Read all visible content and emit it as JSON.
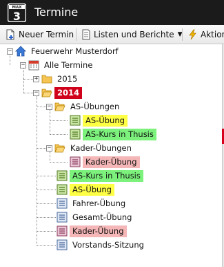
{
  "window": {
    "title": "Termine",
    "app_icon_text": "MAX",
    "app_icon_number": "3"
  },
  "toolbar": {
    "new_appointment": "Neuer Termin",
    "lists_reports": "Listen und Berichte",
    "actions": "Aktion"
  },
  "tree": {
    "root": "Feuerwehr Musterdorf",
    "all_appointments": "Alle Termine",
    "year_2015": "2015",
    "year_2014": "2014",
    "as_uebungen": "AS-Übungen",
    "as_uebung_1": "AS-Übung",
    "as_kurs_1": "AS-Kurs in Thusis",
    "kader_uebungen": "Kader-Übungen",
    "kader_uebung_1": "Kader-Übung",
    "as_kurs_2": "AS-Kurs in Thusis",
    "as_uebung_2": "AS-Übung",
    "fahrer_uebung": "Fahrer-Übung",
    "gesamt_uebung": "Gesamt-Übung",
    "kader_uebung_2": "Kader-Übung",
    "vorstands_sitzung": "Vorstands-Sitzung"
  },
  "colors": {
    "titlebar": "#1b1b1b",
    "highlight_yellow": "#ffff44",
    "highlight_green": "#7cf27c",
    "highlight_pink": "#f4b6b6",
    "highlight_red": "#d0021b"
  }
}
